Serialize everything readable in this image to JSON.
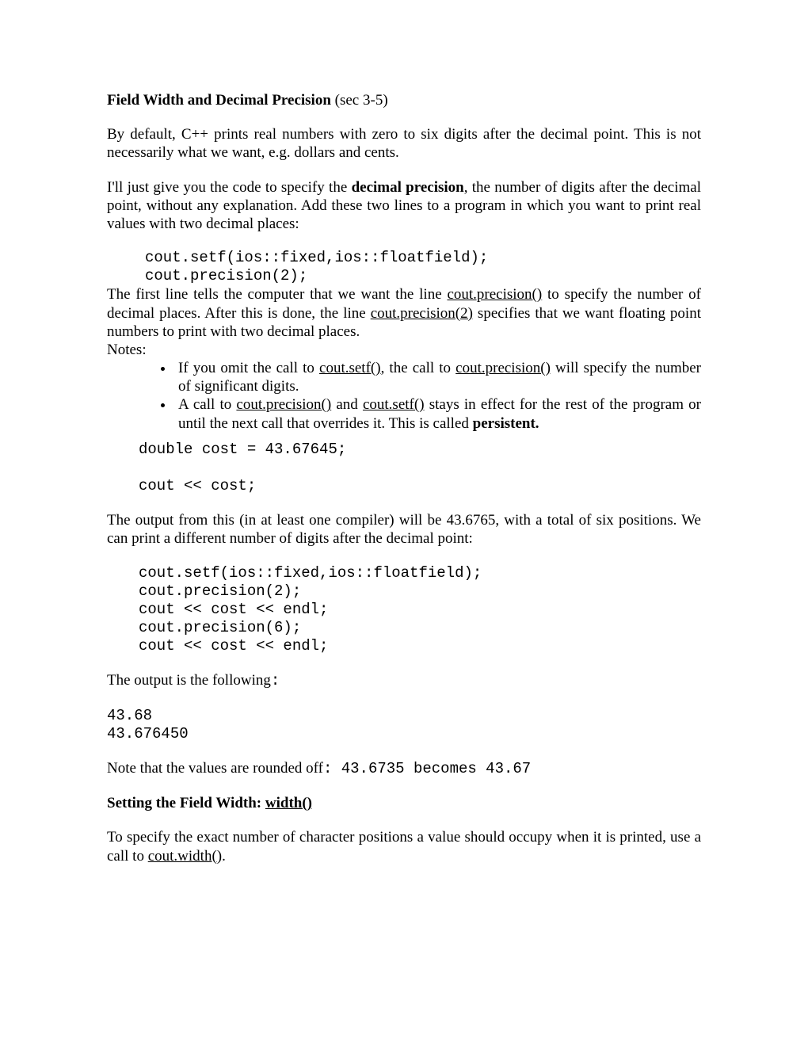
{
  "title_bold": "Field Width and Decimal Precision",
  "title_rest": " (sec 3-5)",
  "p1": "By default, C++ prints real numbers with zero to six digits after the decimal point.  This is not necessarily what we want, e.g. dollars and cents.",
  "p2a": "I'll just give you the code to specify the ",
  "p2b": "decimal precision",
  "p2c": ", the number of digits after the decimal point, without any explanation.  Add these two lines to a program in which you want to print real values with two decimal places:",
  "code1": "cout.setf(ios::fixed,ios::floatfield);\ncout.precision(2);",
  "p3a": "The first line tells the computer that we want the line ",
  "p3b": "cout.precision()",
  "p3c": " to specify the number of decimal places. After this is done, the line ",
  "p3d": "cout.precision(2)",
  "p3e": " specifies that we want floating point numbers to print with two decimal places.",
  "notes_label": "Notes:",
  "b1a": "If you omit the call to ",
  "b1b": "cout.setf()",
  "b1c": ", the call to ",
  "b1d": "cout.precision()",
  "b1e": " will specify the number of significant digits.",
  "b2a": "A call to ",
  "b2b": "cout.precision()",
  "b2c": " and ",
  "b2d": "cout.setf()",
  "b2e": " stays in effect for the rest of the program or until the next call that overrides it. This is called ",
  "b2f": "persistent.",
  "code2": "double cost = 43.67645;\n\ncout << cost;",
  "p4": "The output from this (in at least one compiler) will be 43.6765, with a total of six positions. We can print a different number of digits after the decimal point:",
  "code3": "cout.setf(ios::fixed,ios::floatfield);\ncout.precision(2);\ncout << cost << endl;\ncout.precision(6);\ncout << cost << endl;",
  "p5a": "The output is the following",
  "p5b": ":",
  "out1": "43.68\n43.676450",
  "p6a": "Note that the values are rounded off",
  "p6b": ": 43.6735 becomes 43.67",
  "h2a": "Setting the Field Width: ",
  "h2b": "width()",
  "p7a": "To specify the exact number of character positions a value should occupy when it is printed, use a call to ",
  "p7b": "cout.width()",
  "p7c": "."
}
